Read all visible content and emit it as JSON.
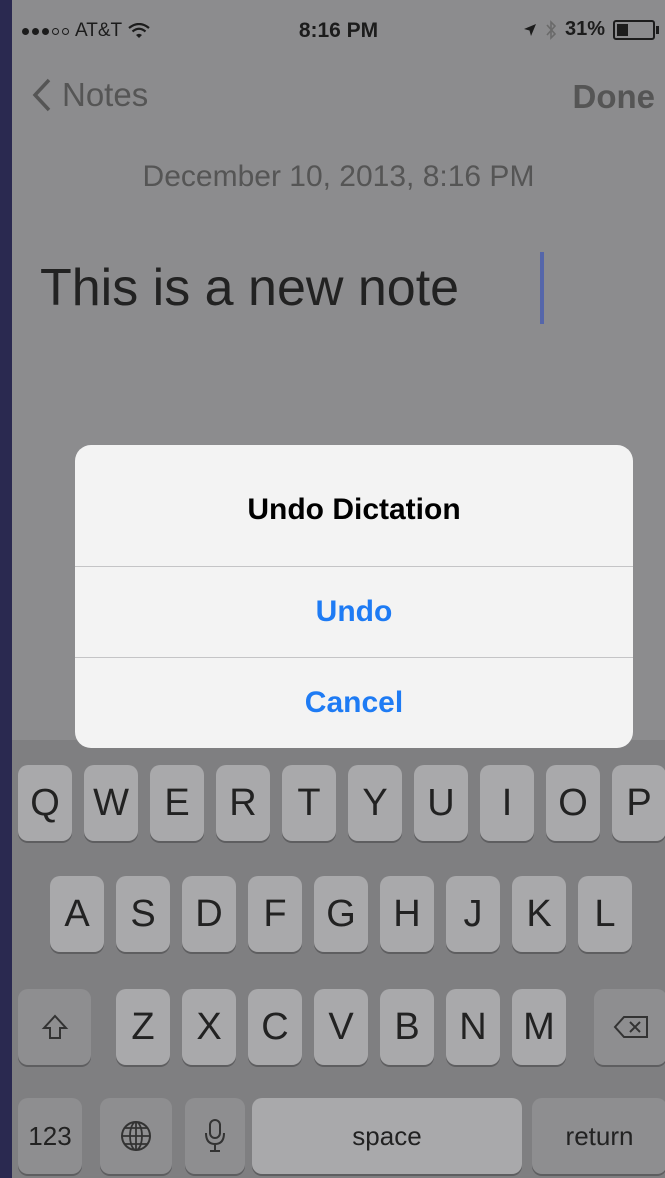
{
  "status_bar": {
    "carrier": "AT&T",
    "time": "8:16 PM",
    "battery": "31%",
    "battery_level": 0.31
  },
  "nav": {
    "back_label": "Notes",
    "done_label": "Done"
  },
  "note": {
    "date": "December 10, 2013, 8:16 PM",
    "text": "This is a new note"
  },
  "alert": {
    "title": "Undo Dictation",
    "undo_label": "Undo",
    "cancel_label": "Cancel"
  },
  "keyboard": {
    "row1": [
      "Q",
      "W",
      "E",
      "R",
      "T",
      "Y",
      "U",
      "I",
      "O",
      "P"
    ],
    "row2": [
      "A",
      "S",
      "D",
      "F",
      "G",
      "H",
      "J",
      "K",
      "L"
    ],
    "row3": [
      "Z",
      "X",
      "C",
      "V",
      "B",
      "N",
      "M"
    ],
    "numbers_label": "123",
    "space_label": "space",
    "return_label": "return"
  }
}
